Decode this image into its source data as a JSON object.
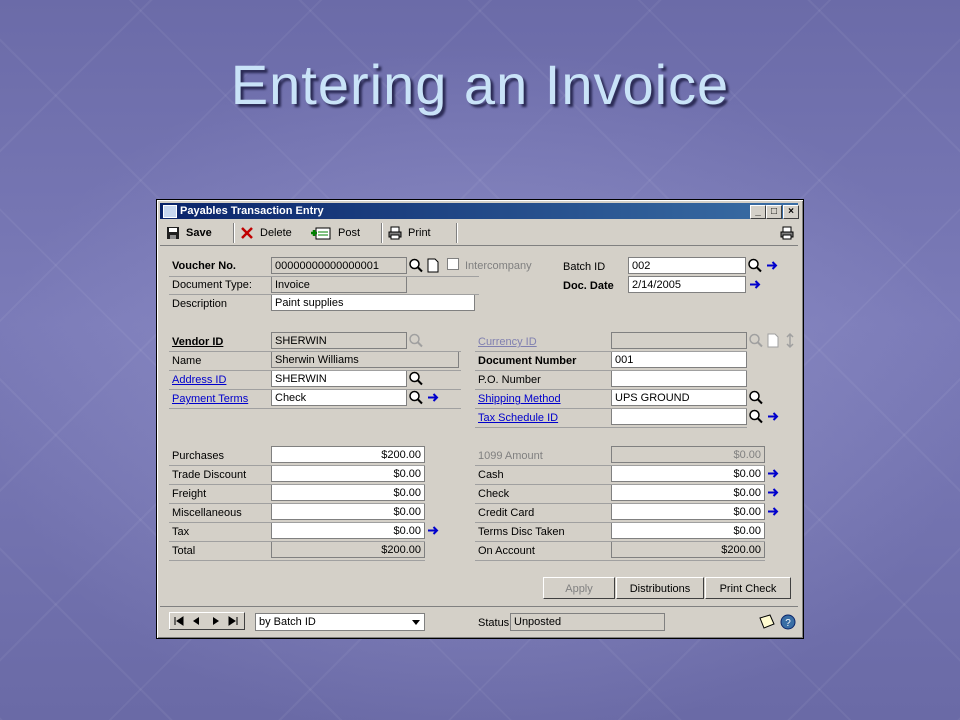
{
  "slide": {
    "title": "Entering an Invoice"
  },
  "window": {
    "title": "Payables Transaction Entry",
    "controls": {
      "minimize": "_",
      "maximize": "□",
      "close": "×"
    }
  },
  "toolbar": {
    "save": "Save",
    "delete": "Delete",
    "post": "Post",
    "print": "Print"
  },
  "header": {
    "voucher_label": "Voucher No.",
    "voucher_value": "00000000000000001",
    "doc_type_label": "Document Type:",
    "doc_type_value": "Invoice",
    "description_label": "Description",
    "description_value": "Paint supplies",
    "intercompany_label": "Intercompany",
    "batch_label": "Batch ID",
    "batch_value": "002",
    "doc_date_label": "Doc. Date",
    "doc_date_value": "2/14/2005"
  },
  "vendor": {
    "vendor_id_label": "Vendor ID",
    "vendor_id_value": "SHERWIN",
    "name_label": "Name",
    "name_value": "Sherwin Williams",
    "address_label": "Address ID",
    "address_value": "SHERWIN",
    "payment_terms_label": "Payment Terms",
    "payment_terms_value": "Check",
    "currency_label": "Currency ID",
    "currency_value": "",
    "doc_number_label": "Document Number",
    "doc_number_value": "001",
    "po_label": "P.O. Number",
    "po_value": "",
    "shipping_label": "Shipping Method",
    "shipping_value": "UPS GROUND",
    "tax_schedule_label": "Tax Schedule ID",
    "tax_schedule_value": ""
  },
  "amounts_left": {
    "purchases_label": "Purchases",
    "purchases_value": "$200.00",
    "trade_discount_label": "Trade Discount",
    "trade_discount_value": "$0.00",
    "freight_label": "Freight",
    "freight_value": "$0.00",
    "misc_label": "Miscellaneous",
    "misc_value": "$0.00",
    "tax_label": "Tax",
    "tax_value": "$0.00",
    "total_label": "Total",
    "total_value": "$200.00"
  },
  "amounts_right": {
    "amount1099_label": "1099 Amount",
    "amount1099_value": "$0.00",
    "cash_label": "Cash",
    "cash_value": "$0.00",
    "check_label": "Check",
    "check_value": "$0.00",
    "credit_card_label": "Credit Card",
    "credit_card_value": "$0.00",
    "terms_disc_label": "Terms Disc Taken",
    "terms_disc_value": "$0.00",
    "on_account_label": "On Account",
    "on_account_value": "$200.00"
  },
  "buttons": {
    "apply": "Apply",
    "distributions": "Distributions",
    "print_check": "Print Check"
  },
  "footer": {
    "sort_value": "by Batch ID",
    "status_label": "Status",
    "status_value": "Unposted"
  },
  "colors": {
    "titlebar": "#0a246a",
    "link": "#0000cc",
    "window_bg": "#d4d0c8",
    "slide_title": "#c9e3f8"
  }
}
